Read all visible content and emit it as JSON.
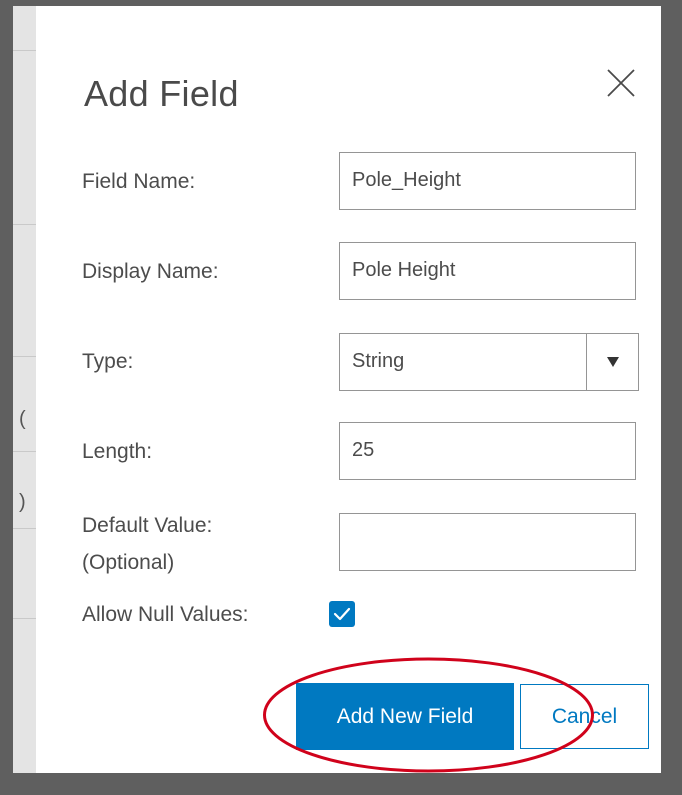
{
  "dialog": {
    "title": "Add Field",
    "close_icon": "close-icon"
  },
  "form": {
    "field_name": {
      "label": "Field Name:",
      "value": "Pole_Height"
    },
    "display_name": {
      "label": "Display Name:",
      "value": "Pole Height"
    },
    "type": {
      "label": "Type:",
      "value": "String",
      "arrow_icon": "caret-down-icon"
    },
    "length": {
      "label": "Length:",
      "value": "25"
    },
    "default_value": {
      "label_line1": "Default Value:",
      "label_line2": "(Optional)",
      "value": ""
    },
    "allow_null": {
      "label": "Allow Null Values:",
      "checked": true,
      "icon": "checkmark-icon"
    }
  },
  "actions": {
    "add_label": "Add New Field",
    "cancel_label": "Cancel"
  },
  "annotation": {
    "color": "#d0021b",
    "shape": "ellipse"
  },
  "colors": {
    "accent": "#0079c1",
    "overlay": "#5f5f5f",
    "text": "#4c4c4c"
  }
}
